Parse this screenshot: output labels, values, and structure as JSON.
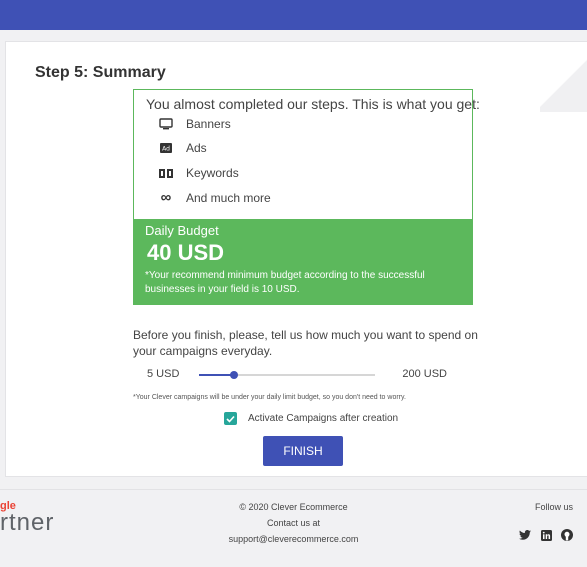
{
  "page": {
    "step_title": "Step 5: Summary"
  },
  "summary": {
    "intro": "You almost completed our steps. This is what you get:",
    "features": [
      {
        "label": "Banners",
        "icon": "monitor-icon"
      },
      {
        "label": "Ads",
        "icon": "ad-icon"
      },
      {
        "label": "Keywords",
        "icon": "keywords-icon"
      },
      {
        "label": "And much more",
        "icon": "infinity-icon"
      }
    ],
    "budget_label": "Daily Budget",
    "budget_amount": "40 USD",
    "budget_note": "*Your recommend minimum budget according to the successful businesses in your field is 10 USD."
  },
  "spend": {
    "question": "Before you finish, please, tell us how much you want to spend on your campaigns everyday.",
    "min_label": "5 USD",
    "max_label": "200 USD",
    "slider_fraction": 0.2,
    "disclaimer": "*Your Clever campaigns will be under your daily limit budget, so you don't need to worry."
  },
  "activate": {
    "label": "Activate Campaigns after creation",
    "checked": true
  },
  "finish_label": "FINISH",
  "footer": {
    "google_top": "gle",
    "google_bottom": "rtner",
    "copyright": "© 2020 Clever Ecommerce",
    "contact": "Contact us at",
    "email": "support@cleverecommerce.com",
    "follow": "Follow us",
    "social": [
      "twitter-icon",
      "linkedin-icon",
      "github-icon"
    ]
  },
  "colors": {
    "topbar": "#3f51b5",
    "green": "#5cb85c",
    "accent": "#3f51b5",
    "check": "#26a69a"
  }
}
